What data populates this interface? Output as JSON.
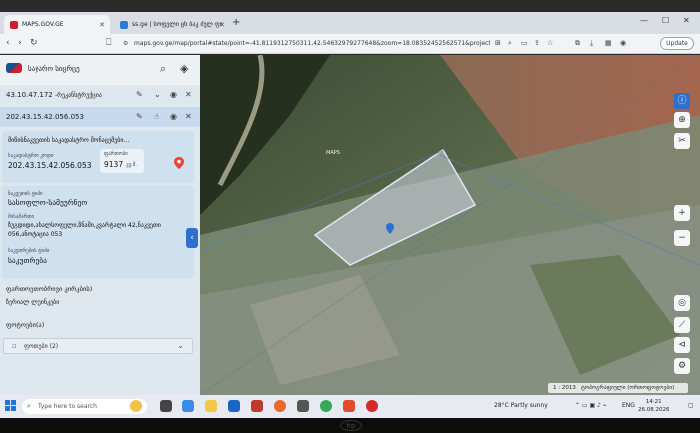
{
  "browser": {
    "tabs": [
      {
        "title": "MAPS.GOV.GE",
        "active": true
      },
      {
        "title": "ss.ge | სოფელი ცხ ბაკ ძელ ფინ... ",
        "active": false
      }
    ],
    "url": "maps.gov.ge/map/portal#state/point=-41.8119312750311,42.54632979277648&zoom=18.08352452562571&projection...",
    "update_label": "Update"
  },
  "panel": {
    "title": "საჯარო სიცრცე",
    "rows": [
      {
        "code": "43.10.47.172",
        "desc": "-რეკანსტრუქცია"
      },
      {
        "code": "202.43.15.42.056.053",
        "desc": ""
      }
    ],
    "card_heading": "მიწისნაკვეთის საკადასტრო მონაცემები...",
    "cadastral_label": "საკადასტრო კოდი",
    "cadastral_value": "202.43.15.42.056.053",
    "area_label": "ფართობი",
    "area_value": "9137",
    "area_unit": "კვ.მ.",
    "purpose_label": "ნაკვეთის ტიპი",
    "purpose_value": "სასოფლო-სამეურნეო",
    "address_label": "მისამართი",
    "address_value": "ზუგდიდი,ახალსოფელი,ზნაში,კვარტალი 42,ნაკვეთი 056,ანოტაცია 053",
    "owner_label": "საკუთრების ტიპი",
    "owner_value": "საკუთრება",
    "section_1": "ფართოეთობრივი კირკბის)",
    "section_1_sub": "ზერიალ ლუინკები",
    "section_2": "ფოტოები(ა)",
    "dropdown_label": "ფოთები (2)"
  },
  "map": {
    "label": "MAPS",
    "scale_value": "1 : 2013",
    "basemap_label": "ტოპოგრაფიული (ორთოფოტოები)"
  },
  "taskbar": {
    "search_placeholder": "Type here to search",
    "weather": "28°C  Partly sunny",
    "lang": "ENG",
    "time": "14:21",
    "date": "26.08.2026"
  }
}
